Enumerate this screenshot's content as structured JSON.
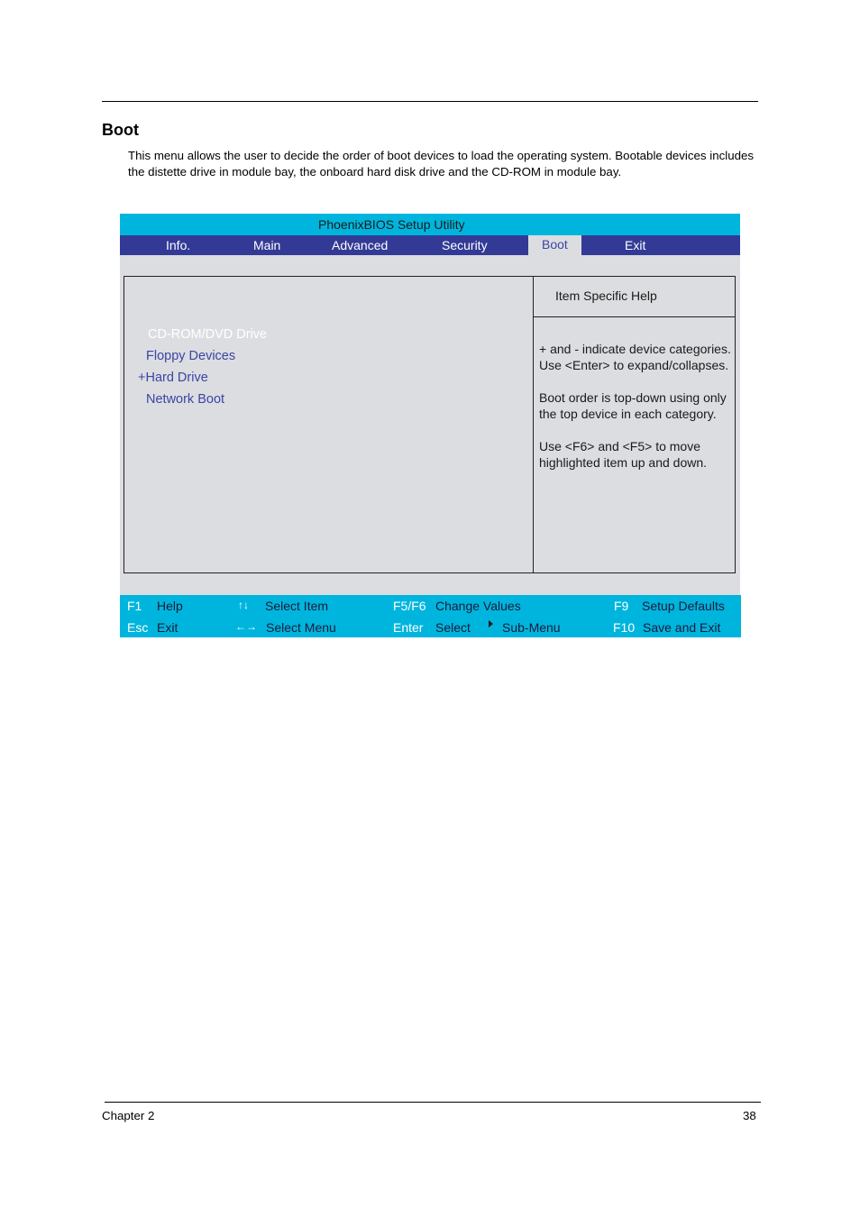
{
  "page": {
    "section_title": "Boot",
    "intro_text": "This menu allows the user to decide the order of boot devices to load the operating system. Bootable devices includes the distette drive in module bay, the onboard hard disk drive and the CD-ROM in module bay.",
    "footer_chapter": "Chapter 2",
    "footer_page_number": "38"
  },
  "bios": {
    "title": "PhoenixBIOS Setup Utility",
    "tabs": [
      {
        "label": "Info.",
        "active": false
      },
      {
        "label": "Main",
        "active": false
      },
      {
        "label": "Advanced",
        "active": false
      },
      {
        "label": "Security",
        "active": false
      },
      {
        "label": "Boot",
        "active": true
      },
      {
        "label": "Exit",
        "active": false
      }
    ],
    "boot_items": [
      {
        "label": "CD-ROM/DVD Drive",
        "selected": true
      },
      {
        "label": "Floppy Devices",
        "selected": false
      },
      {
        "label": "+Hard Drive",
        "selected": false
      },
      {
        "label": "Network Boot",
        "selected": false
      }
    ],
    "help": {
      "title": "Item Specific Help",
      "paragraphs": [
        "+ and - indicate device categories. Use  <Enter> to expand/collapses.",
        "Boot order is top-down using only the top device in each category.",
        "Use <F6> and <F5> to move highlighted item up and down."
      ]
    },
    "keys": [
      {
        "key": "F1",
        "desc": "Help"
      },
      {
        "key": "↑↓",
        "desc": "Select Item"
      },
      {
        "key": "F5/F6",
        "desc": "Change Values"
      },
      {
        "key": "F9",
        "desc": "Setup Defaults"
      },
      {
        "key": "Esc",
        "desc": "Exit"
      },
      {
        "key": "←→",
        "desc": "Select Menu"
      },
      {
        "key": "Enter",
        "desc": "Select",
        "extra": "Sub-Menu",
        "extra_icon": "triangle-right-icon"
      },
      {
        "key": "F10",
        "desc": "Save and Exit"
      }
    ],
    "colors": {
      "title_bar": "#00b5dd",
      "menu_bar": "#333a96",
      "panel_bg": "#dcdde0",
      "item_text": "#3a45a5",
      "selected_text": "#ffffff"
    }
  }
}
